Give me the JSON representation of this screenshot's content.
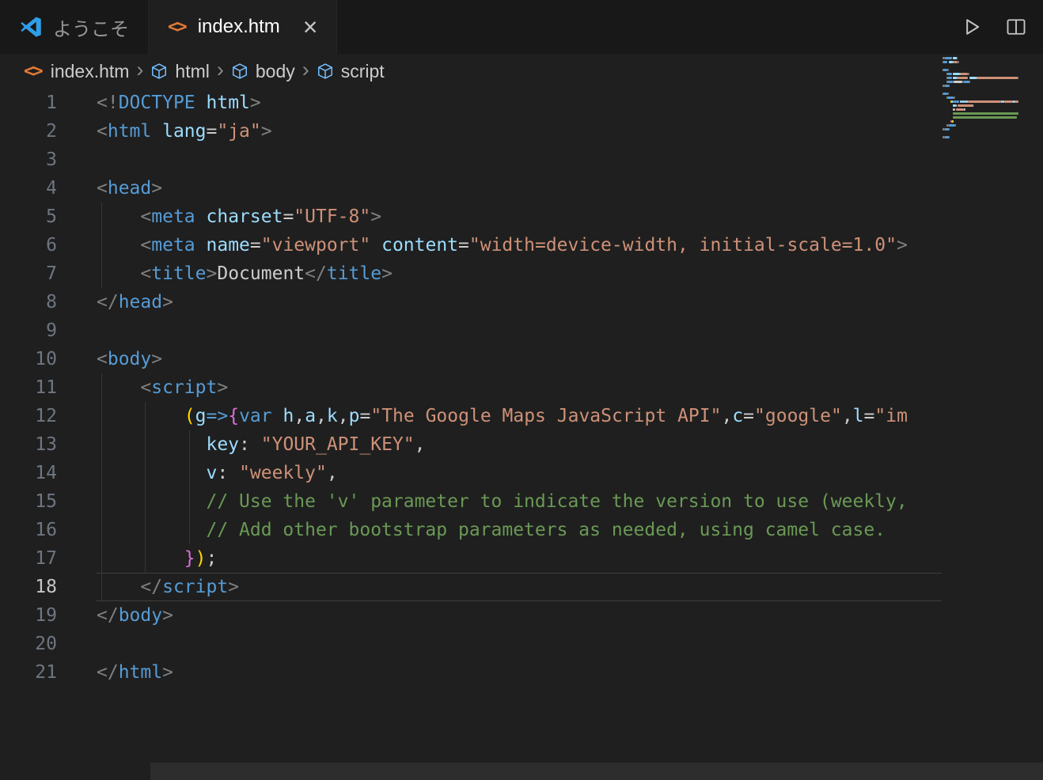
{
  "tab_bar": {
    "welcome_tab": {
      "label": "ようこそ",
      "icon": "vscode-logo-icon"
    },
    "active_tab": {
      "label": "index.htm",
      "icon": "code-file-icon",
      "close_glyph": "×"
    }
  },
  "editor_actions": {
    "run": "run-icon",
    "split_editor": "split-editor-icon"
  },
  "breadcrumb": {
    "separator": "›",
    "file_icon_glyph": "<>",
    "items": [
      {
        "label": "index.htm",
        "icon": "code-file-icon"
      },
      {
        "label": "html",
        "icon": "symbol-cube-icon"
      },
      {
        "label": "body",
        "icon": "symbol-cube-icon"
      },
      {
        "label": "script",
        "icon": "symbol-cube-icon"
      }
    ]
  },
  "editor": {
    "active_line": 18,
    "token_colors": {
      "punct": "#808080",
      "tag": "#569cd6",
      "attr": "#9cdcfe",
      "string": "#ce9178",
      "plain": "#cccccc",
      "keyword": "#569cd6",
      "variable": "#9cdcfe",
      "comment": "#6a9955",
      "bracket1": "#ffd700",
      "bracket2": "#da70d6"
    },
    "lines": [
      {
        "num": 1,
        "tokens": [
          {
            "t": "<!",
            "c": "punct"
          },
          {
            "t": "DOCTYPE",
            "c": "tag"
          },
          {
            "t": " ",
            "c": "plain"
          },
          {
            "t": "html",
            "c": "attr"
          },
          {
            "t": ">",
            "c": "punct"
          }
        ]
      },
      {
        "num": 2,
        "tokens": [
          {
            "t": "<",
            "c": "punct"
          },
          {
            "t": "html",
            "c": "tag"
          },
          {
            "t": " ",
            "c": "plain"
          },
          {
            "t": "lang",
            "c": "attr"
          },
          {
            "t": "=",
            "c": "plain"
          },
          {
            "t": "\"ja\"",
            "c": "string"
          },
          {
            "t": ">",
            "c": "punct"
          }
        ]
      },
      {
        "num": 3,
        "tokens": []
      },
      {
        "num": 4,
        "tokens": [
          {
            "t": "<",
            "c": "punct"
          },
          {
            "t": "head",
            "c": "tag"
          },
          {
            "t": ">",
            "c": "punct"
          }
        ]
      },
      {
        "num": 5,
        "tokens": [
          {
            "t": "    ",
            "c": "plain"
          },
          {
            "t": "<",
            "c": "punct"
          },
          {
            "t": "meta",
            "c": "tag"
          },
          {
            "t": " ",
            "c": "plain"
          },
          {
            "t": "charset",
            "c": "attr"
          },
          {
            "t": "=",
            "c": "plain"
          },
          {
            "t": "\"UTF-8\"",
            "c": "string"
          },
          {
            "t": ">",
            "c": "punct"
          }
        ]
      },
      {
        "num": 6,
        "tokens": [
          {
            "t": "    ",
            "c": "plain"
          },
          {
            "t": "<",
            "c": "punct"
          },
          {
            "t": "meta",
            "c": "tag"
          },
          {
            "t": " ",
            "c": "plain"
          },
          {
            "t": "name",
            "c": "attr"
          },
          {
            "t": "=",
            "c": "plain"
          },
          {
            "t": "\"viewport\"",
            "c": "string"
          },
          {
            "t": " ",
            "c": "plain"
          },
          {
            "t": "content",
            "c": "attr"
          },
          {
            "t": "=",
            "c": "plain"
          },
          {
            "t": "\"width=device-width, initial-scale=1.0\"",
            "c": "string"
          },
          {
            "t": ">",
            "c": "punct"
          }
        ]
      },
      {
        "num": 7,
        "tokens": [
          {
            "t": "    ",
            "c": "plain"
          },
          {
            "t": "<",
            "c": "punct"
          },
          {
            "t": "title",
            "c": "tag"
          },
          {
            "t": ">",
            "c": "punct"
          },
          {
            "t": "Document",
            "c": "plain"
          },
          {
            "t": "</",
            "c": "punct"
          },
          {
            "t": "title",
            "c": "tag"
          },
          {
            "t": ">",
            "c": "punct"
          }
        ]
      },
      {
        "num": 8,
        "tokens": [
          {
            "t": "</",
            "c": "punct"
          },
          {
            "t": "head",
            "c": "tag"
          },
          {
            "t": ">",
            "c": "punct"
          }
        ]
      },
      {
        "num": 9,
        "tokens": []
      },
      {
        "num": 10,
        "tokens": [
          {
            "t": "<",
            "c": "punct"
          },
          {
            "t": "body",
            "c": "tag"
          },
          {
            "t": ">",
            "c": "punct"
          }
        ]
      },
      {
        "num": 11,
        "tokens": [
          {
            "t": "    ",
            "c": "plain"
          },
          {
            "t": "<",
            "c": "punct"
          },
          {
            "t": "script",
            "c": "tag"
          },
          {
            "t": ">",
            "c": "punct"
          }
        ]
      },
      {
        "num": 12,
        "tokens": [
          {
            "t": "        ",
            "c": "plain"
          },
          {
            "t": "(",
            "c": "bracket1"
          },
          {
            "t": "g",
            "c": "variable"
          },
          {
            "t": "=>",
            "c": "keyword"
          },
          {
            "t": "{",
            "c": "bracket2"
          },
          {
            "t": "var",
            "c": "keyword"
          },
          {
            "t": " ",
            "c": "plain"
          },
          {
            "t": "h",
            "c": "variable"
          },
          {
            "t": ",",
            "c": "plain"
          },
          {
            "t": "a",
            "c": "variable"
          },
          {
            "t": ",",
            "c": "plain"
          },
          {
            "t": "k",
            "c": "variable"
          },
          {
            "t": ",",
            "c": "plain"
          },
          {
            "t": "p",
            "c": "variable"
          },
          {
            "t": "=",
            "c": "plain"
          },
          {
            "t": "\"The Google Maps JavaScript API\"",
            "c": "string"
          },
          {
            "t": ",",
            "c": "plain"
          },
          {
            "t": "c",
            "c": "variable"
          },
          {
            "t": "=",
            "c": "plain"
          },
          {
            "t": "\"google\"",
            "c": "string"
          },
          {
            "t": ",",
            "c": "plain"
          },
          {
            "t": "l",
            "c": "variable"
          },
          {
            "t": "=",
            "c": "plain"
          },
          {
            "t": "\"im",
            "c": "string"
          }
        ]
      },
      {
        "num": 13,
        "tokens": [
          {
            "t": "          ",
            "c": "plain"
          },
          {
            "t": "key",
            "c": "attr"
          },
          {
            "t": ":",
            "c": "plain"
          },
          {
            "t": " ",
            "c": "plain"
          },
          {
            "t": "\"YOUR_API_KEY\"",
            "c": "string"
          },
          {
            "t": ",",
            "c": "plain"
          }
        ]
      },
      {
        "num": 14,
        "tokens": [
          {
            "t": "          ",
            "c": "plain"
          },
          {
            "t": "v",
            "c": "attr"
          },
          {
            "t": ":",
            "c": "plain"
          },
          {
            "t": " ",
            "c": "plain"
          },
          {
            "t": "\"weekly\"",
            "c": "string"
          },
          {
            "t": ",",
            "c": "plain"
          }
        ]
      },
      {
        "num": 15,
        "tokens": [
          {
            "t": "          ",
            "c": "plain"
          },
          {
            "t": "// Use the 'v' parameter to indicate the version to use (weekly,",
            "c": "comment"
          }
        ]
      },
      {
        "num": 16,
        "tokens": [
          {
            "t": "          ",
            "c": "plain"
          },
          {
            "t": "// Add other bootstrap parameters as needed, using camel case.",
            "c": "comment"
          }
        ]
      },
      {
        "num": 17,
        "tokens": [
          {
            "t": "        ",
            "c": "plain"
          },
          {
            "t": "}",
            "c": "bracket2"
          },
          {
            "t": ")",
            "c": "bracket1"
          },
          {
            "t": ";",
            "c": "plain"
          }
        ]
      },
      {
        "num": 18,
        "tokens": [
          {
            "t": "    ",
            "c": "plain"
          },
          {
            "t": "</",
            "c": "punct"
          },
          {
            "t": "script",
            "c": "tag"
          },
          {
            "t": ">",
            "c": "punct"
          }
        ]
      },
      {
        "num": 19,
        "tokens": [
          {
            "t": "</",
            "c": "punct"
          },
          {
            "t": "body",
            "c": "tag"
          },
          {
            "t": ">",
            "c": "punct"
          }
        ]
      },
      {
        "num": 20,
        "tokens": []
      },
      {
        "num": 21,
        "tokens": [
          {
            "t": "</",
            "c": "punct"
          },
          {
            "t": "html",
            "c": "tag"
          },
          {
            "t": ">",
            "c": "punct"
          }
        ]
      }
    ]
  }
}
